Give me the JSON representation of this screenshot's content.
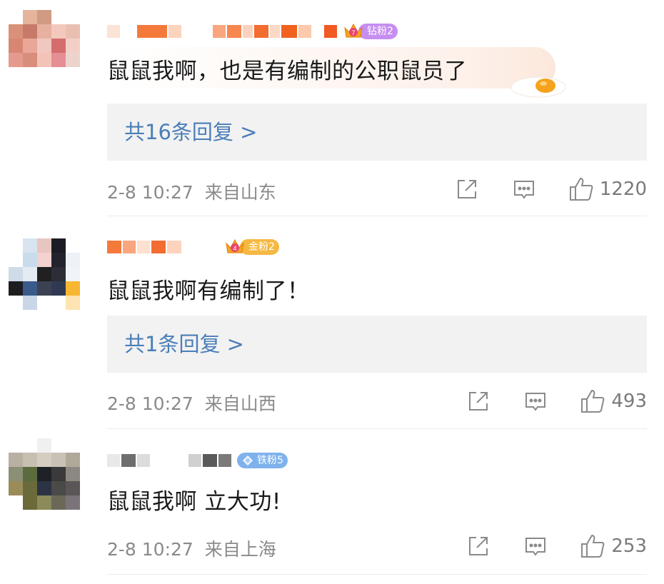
{
  "comments": [
    {
      "badge": "钻粉2",
      "badge_level_digit": "7",
      "text": "鼠鼠我啊，也是有编制的公职鼠员了",
      "replies": "共16条回复 >",
      "time": "2-8 10:27",
      "location": "来自山东",
      "likes": "1220",
      "avatar_colors": [
        "#ffffff",
        "#e6b49a",
        "#d19a82",
        "#ffffff",
        "#ffffff",
        "#d9917a",
        "#c77a6a",
        "#e7b0a0",
        "#f3c9bd",
        "#e9bfb2",
        "#d88674",
        "#e9a797",
        "#f1c8bf",
        "#d46d6d",
        "#f2d0c7",
        "#e49a8c",
        "#d98d7c",
        "#f3c3b8",
        "#e58e94",
        "#ecd4cd",
        "#ffffff",
        "#ffffff",
        "#ffffff",
        "#ffffff",
        "#ffffff"
      ]
    },
    {
      "badge": "金粉2",
      "badge_level_digit": "4",
      "text": "鼠鼠我啊有编制了！",
      "replies": "共1条回复 >",
      "time": "2-8 10:27",
      "location": "来自山西",
      "likes": "493",
      "avatar_colors": [
        "#ffffff",
        "#d8e4f0",
        "#e8c6c0",
        "#1c1c24",
        "#ffffff",
        "#ffffff",
        "#c9dceb",
        "#f4d2cf",
        "#23232e",
        "#eef2f7",
        "#cfdbe8",
        "#e4ebf2",
        "#202020",
        "#2d2d38",
        "#f0f4f8",
        "#1d1d20",
        "#3a5a8a",
        "#3c4252",
        "#2f3a52",
        "#f7b733",
        "#ffffff",
        "#c8d6e8",
        "#ffffff",
        "#ffffff",
        "#fde4b0"
      ]
    },
    {
      "badge": "铁粉5",
      "text": "鼠鼠我啊 立大功!",
      "time": "2-8 10:27",
      "location": "来自上海",
      "likes": "253",
      "avatar_colors": [
        "#ffffff",
        "#ffffff",
        "#f0f0f0",
        "#ffffff",
        "#ffffff",
        "#b8b0a2",
        "#c7c0b0",
        "#d4cdc0",
        "#c8c2b6",
        "#b0a898",
        "#8a8f76",
        "#5b6b3e",
        "#1e2126",
        "#3a3a3a",
        "#8c8780",
        "#9a8c5a",
        "#6a6a3a",
        "#2c3344",
        "#4a4a48",
        "#5a5556",
        "#ffffff",
        "#6b6a38",
        "#8a8a5a",
        "#6b6858",
        "#7a7478"
      ]
    }
  ],
  "colors": {
    "diamond_badge": "#c68ef0",
    "gold_badge": "#f5b842",
    "iron_badge": "#7fb2ec",
    "reply_link": "#4a7eb8"
  }
}
